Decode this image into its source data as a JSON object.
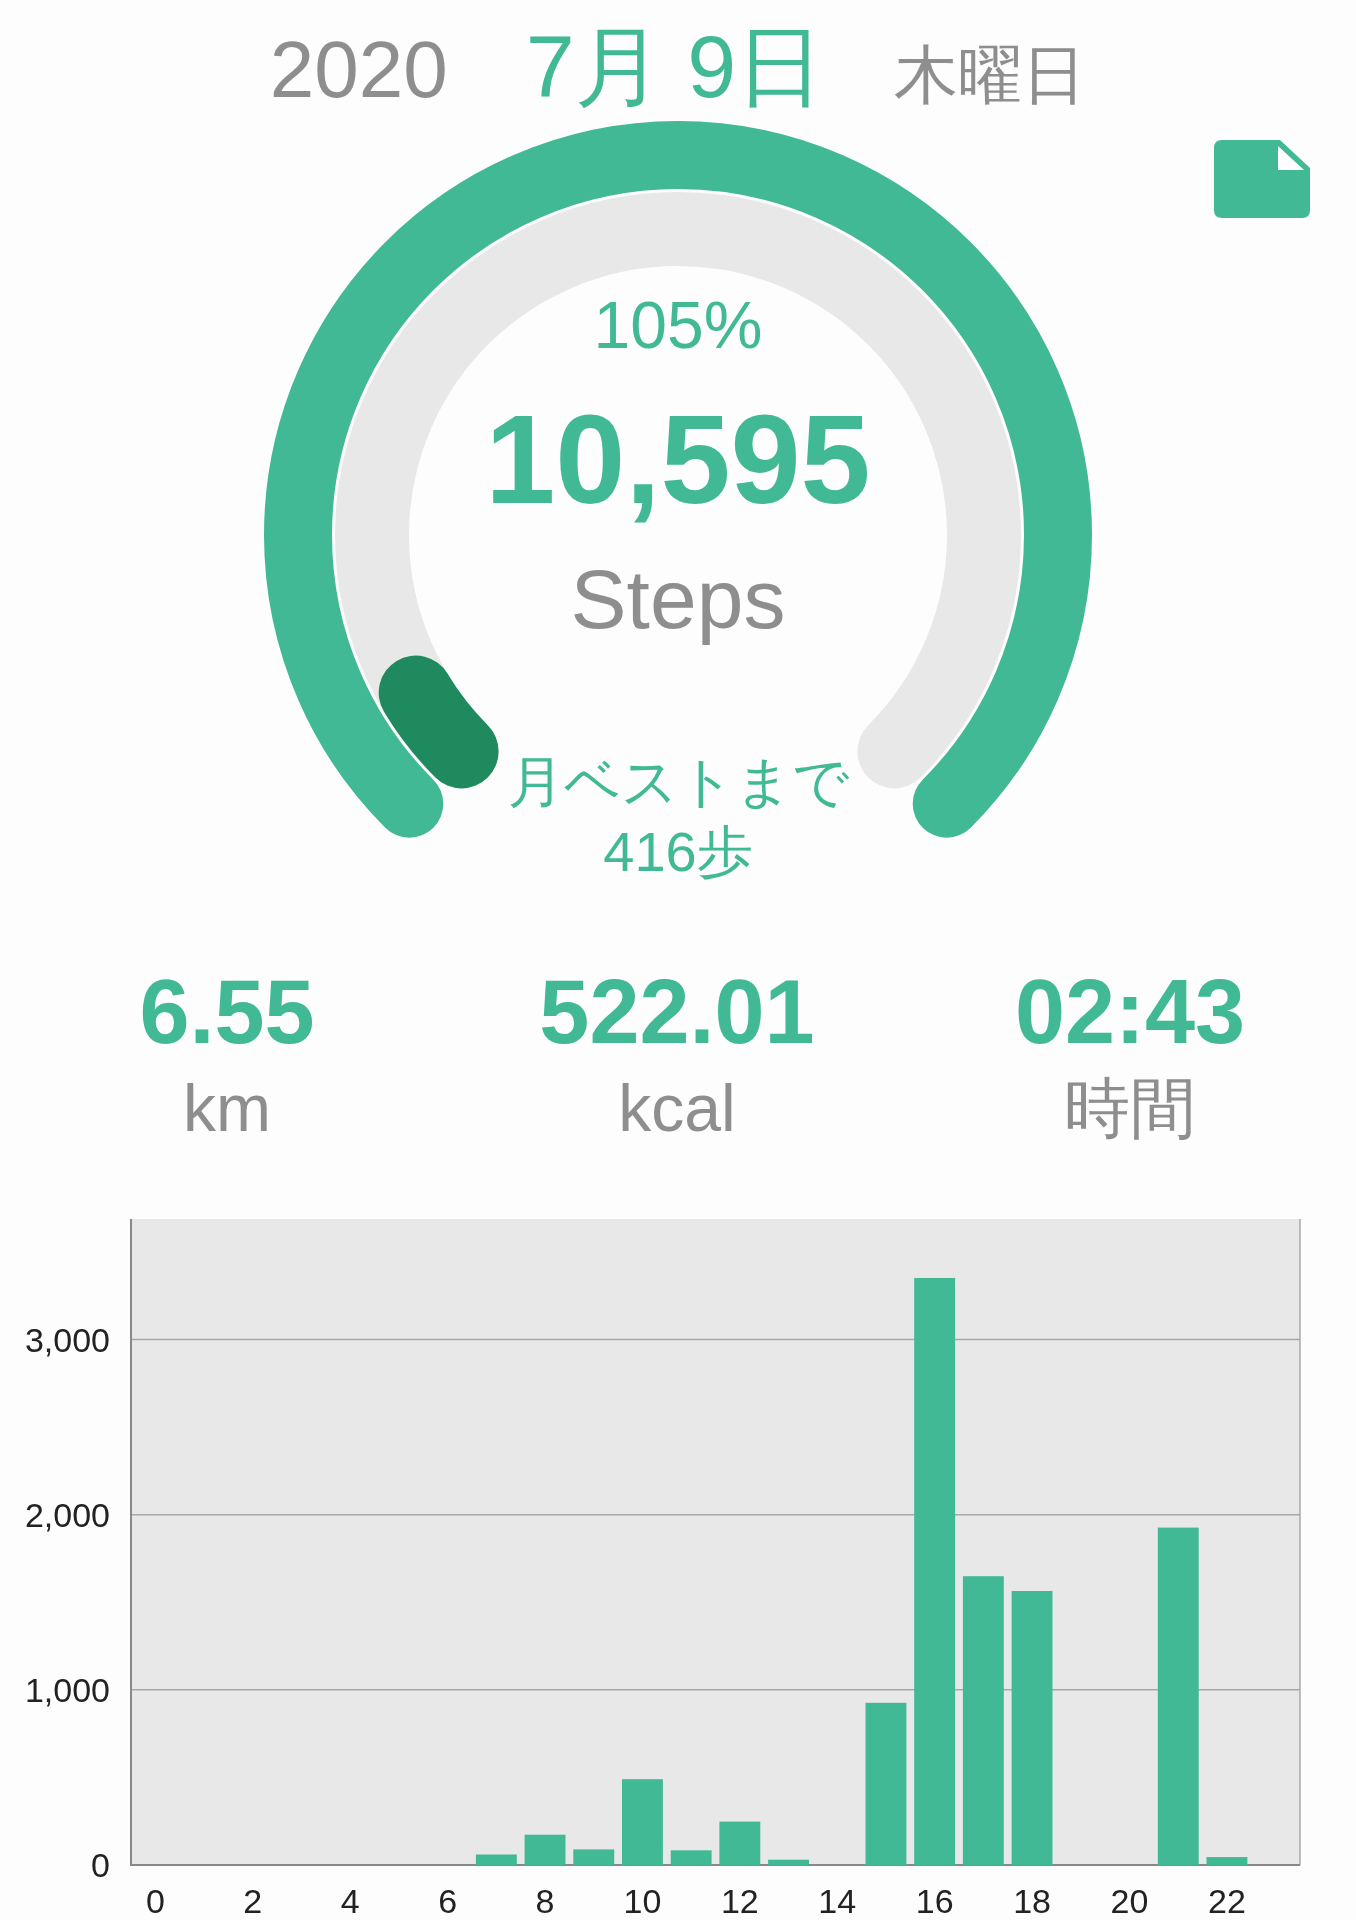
{
  "header": {
    "year": "2020",
    "date": "7月 9日",
    "weekday": "木曜日"
  },
  "gauge": {
    "percent": "105%",
    "steps": "10,595",
    "unit": "Steps",
    "best_label": "月ベストまで",
    "best_remaining": "416歩"
  },
  "stats": [
    {
      "value": "6.55",
      "unit": "km"
    },
    {
      "value": "522.01",
      "unit": "kcal"
    },
    {
      "value": "02:43",
      "unit": "時間"
    }
  ],
  "chart": {
    "chart_data": {
      "type": "bar",
      "x": [
        0,
        1,
        2,
        3,
        4,
        5,
        6,
        7,
        8,
        9,
        10,
        11,
        12,
        13,
        14,
        15,
        16,
        17,
        18,
        19,
        20,
        21,
        22,
        23
      ],
      "grid": true,
      "ylim": [
        0,
        3688
      ],
      "xlim": [
        -0.5,
        23.5
      ],
      "yticks": [
        {
          "value": 0,
          "label": "0"
        },
        {
          "value": 1000,
          "label": "1,000"
        },
        {
          "value": 2000,
          "label": "2,000"
        },
        {
          "value": 3000,
          "label": "3,000"
        }
      ],
      "xticks": [
        0,
        2,
        4,
        6,
        8,
        10,
        12,
        14,
        16,
        18,
        20,
        22
      ],
      "series": [
        {
          "color": "#41b995",
          "values": [
            0,
            0,
            0,
            0,
            0,
            0,
            0,
            60,
            173,
            89,
            490,
            84,
            248,
            30,
            0,
            926,
            3351,
            1649,
            1564,
            0,
            0,
            1926,
            45,
            0
          ]
        }
      ]
    }
  }
}
